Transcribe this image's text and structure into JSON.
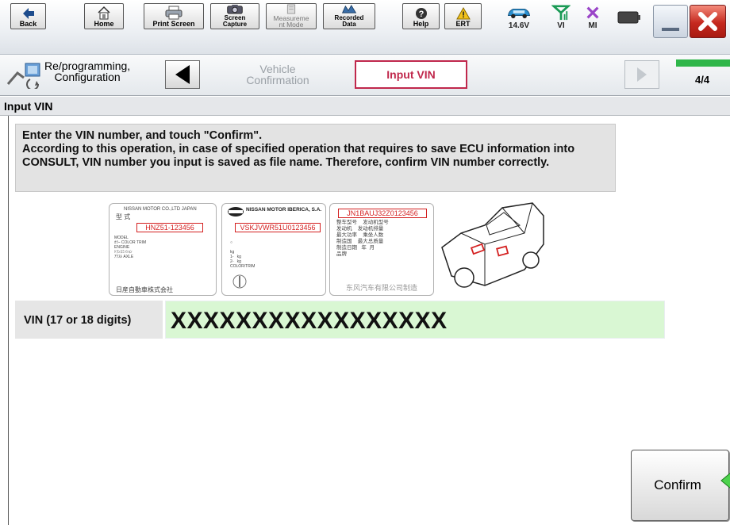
{
  "toolbar": {
    "back": "Back",
    "home": "Home",
    "print_screen": "Print Screen",
    "screen_capture_1": "Screen",
    "screen_capture_2": "Capture",
    "measurement_1": "Measureme",
    "measurement_2": "nt Mode",
    "recorded_1": "Recorded",
    "recorded_2": "Data",
    "help": "Help",
    "ert": "ERT",
    "voltage": "14.6V",
    "vi": "VI",
    "mi": "MI"
  },
  "stepbar": {
    "reprog_1": "Re/programming,",
    "reprog_2": "Configuration",
    "vehicle_1": "Vehicle",
    "vehicle_2": "Confirmation",
    "input_vin": "Input VIN",
    "page": "4/4",
    "progress_fraction": 1.0
  },
  "title": "Input VIN",
  "instructions": {
    "line1": "Enter the VIN number, and touch \"Confirm\".",
    "line2": "According to this operation, in case of specified operation that requires to save ECU information into CONSULT, VIN number you input is saved as file name. Therefore, confirm VIN number correctly."
  },
  "plates": {
    "p1_header": "NISSAN MOTOR CO.,LTD JAPAN",
    "p1_vin": "HNZ51-123456",
    "p1_footer": "日産自動車株式会社",
    "p2_header": "NISSAN MOTOR IBERICA, S.A.",
    "p2_vin": "VSKJVWR51U0123456",
    "p3_vin": "JN1BAUJ32Z0123456",
    "p3_footer": "东风汽车有限公司制造"
  },
  "vin": {
    "label": "VIN (17 or 18 digits)",
    "value": "XXXXXXXXXXXXXXXXX"
  },
  "confirm": "Confirm",
  "colors": {
    "accent_red": "#c0284c",
    "vin_field_bg": "#d9f7d3",
    "progress_green": "#2fb64a"
  }
}
